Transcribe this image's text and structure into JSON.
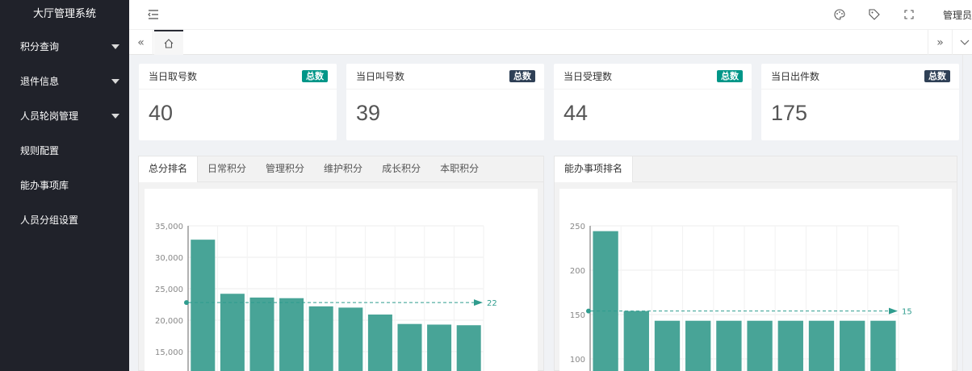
{
  "app": {
    "title": "大厅管理系统"
  },
  "sidebar": {
    "items": [
      {
        "label": "积分查询",
        "has_caret": true
      },
      {
        "label": "退件信息",
        "has_caret": true
      },
      {
        "label": "人员轮岗管理",
        "has_caret": true
      },
      {
        "label": "规则配置",
        "has_caret": false
      },
      {
        "label": "能办事项库",
        "has_caret": false
      },
      {
        "label": "人员分组设置",
        "has_caret": false
      }
    ]
  },
  "header": {
    "user": "管理员"
  },
  "stats": [
    {
      "title": "当日取号数",
      "badge": "总数",
      "badge_color": "#009688",
      "value": "40"
    },
    {
      "title": "当日叫号数",
      "badge": "总数",
      "badge_color": "#2f4056",
      "value": "39"
    },
    {
      "title": "当日受理数",
      "badge": "总数",
      "badge_color": "#009688",
      "value": "44"
    },
    {
      "title": "当日出件数",
      "badge": "总数",
      "badge_color": "#2f4056",
      "value": "175"
    }
  ],
  "left_panel": {
    "tabs": [
      "总分排名",
      "日常积分",
      "管理积分",
      "维护积分",
      "成长积分",
      "本职积分"
    ]
  },
  "right_panel": {
    "tabs": [
      "能办事项排名"
    ]
  },
  "colors": {
    "bar": "#48a497",
    "avg_line": "#2f9c8e",
    "sidebar": "#20222a"
  },
  "chart_data": [
    {
      "type": "bar",
      "title": "",
      "values": [
        32800,
        24200,
        23600,
        23500,
        22200,
        22000,
        20900,
        19400,
        19300,
        19200
      ],
      "ylim": [
        15000,
        35000
      ],
      "yticks": [
        "35,000",
        "30,000",
        "25,000",
        "20,000",
        "15,000"
      ],
      "markline_label": "22",
      "markline_value": 22800,
      "grid": true
    },
    {
      "type": "bar",
      "title": "",
      "values": [
        244,
        154,
        143,
        143,
        143,
        143,
        143,
        143,
        143,
        143
      ],
      "ylim": [
        100,
        250
      ],
      "yticks": [
        "250",
        "200",
        "150",
        "100"
      ],
      "markline_label": "15",
      "markline_value": 154,
      "grid": true
    }
  ]
}
